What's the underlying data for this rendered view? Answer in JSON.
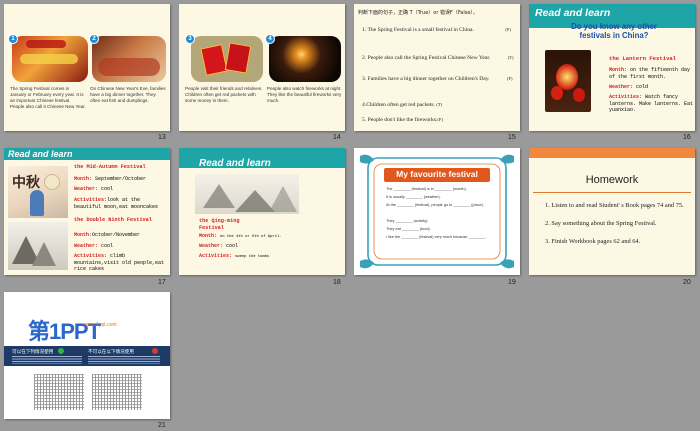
{
  "slides": {
    "s13": {
      "number": "13",
      "badge1": "1",
      "badge2": "2",
      "text1": "The Spring Festival comes in January or February every year. It is an important Chinese festival. People also call it Chinese New Year.",
      "text2": "On Chinese New Year's Eve, families have a big dinner together. They often eat fish and dumplings."
    },
    "s14": {
      "number": "14",
      "badge3": "3",
      "badge4": "4",
      "text3": "People visit their friends and relatives. Children often get red packets with some money in them.",
      "text4": "People also watch fireworks at night. They like the beautiful fireworks very much."
    },
    "s15": {
      "number": "15",
      "instruction": "判断下面的句子，正确 T（True）or 错误F（False）。",
      "items": [
        {
          "text": "1. The Spring Festival is a small festival in China.",
          "answer": "(F)"
        },
        {
          "text": "2. People also call the Spring Festival Chinese New Year.",
          "answer": "(T)"
        },
        {
          "text": "3. Families have a big dinner together on Children's Day.",
          "answer": "(F)"
        },
        {
          "text": "4.Children often get red packets.",
          "answer": "(T)"
        },
        {
          "text": "5. People don't like the fireworks.",
          "answer": "(F)"
        }
      ]
    },
    "s16": {
      "number": "16",
      "heading": "Read and learn",
      "question": "Do you know any other festivals in China?",
      "festival": "the Lantern Festival",
      "month_label": "Month:",
      "month_value": "on the fifteenth day of the first month.",
      "weather_label": "Weather:",
      "weather_value": "cold",
      "activities_label": "Activities:",
      "activities_value": "Watch fancy lanterns. Make lanterns. Eat yuanxiao."
    },
    "s17": {
      "number": "17",
      "heading": "Read and learn",
      "f1": "the Mid-Autumn Festival",
      "f1_month_label": "Month:",
      "f1_month": "September/October",
      "f1_weather_label": "Weather:",
      "f1_weather": "cool",
      "f1_act_label": "Activities:",
      "f1_act": "look at the beautiful moon,eat mooncakes",
      "f2": "the Double Ninth Festival",
      "f2_month_label": "Month:",
      "f2_month": "October/November",
      "f2_weather_label": "Weather:",
      "f2_weather": "cool",
      "f2_act_label": "Activities:",
      "f2_act": "climb mountains,visit old people,eat rice cakes",
      "art_text": "中秋"
    },
    "s18": {
      "number": "18",
      "heading": "Read and learn",
      "festival": "the Qing-ming Festival",
      "month_label": "Month:",
      "month_value": "on the 4th or 5th of April.",
      "weather_label": "Weather:",
      "weather_value": "cool",
      "act_label": "Activities:",
      "act_value": "sweep the tombs"
    },
    "s19": {
      "number": "19",
      "title": "My favourite festival",
      "lines": [
        "The ________ (festival) is in ________ (month).",
        "It is usually ________ (weather).",
        "At the ________ (festival), people go to ________ (place).",
        "They ________ (activity).",
        "They eat ________ (food).",
        "I like the ________ (festival) very much because ________."
      ]
    },
    "s20": {
      "number": "20",
      "title": "Homework",
      "items": [
        "1. Listen to and read Student' s Book pages 74 and 75.",
        "2. Say something about the Spring Festival.",
        "3. Finish Workbook pages 62 and 64."
      ]
    },
    "s21": {
      "number": "21",
      "logo_main": "第1PPT",
      "logo_sub": "www.1ppt.com",
      "col1_title": "可以在下列情况使用",
      "col2_title": "不可以在以下情况使用"
    }
  },
  "colors": {
    "teal": "#1ea5a8",
    "red": "#d42020",
    "blue": "#1a8fd6",
    "cream": "#fdf8e4",
    "orange": "#ec6a1c"
  }
}
